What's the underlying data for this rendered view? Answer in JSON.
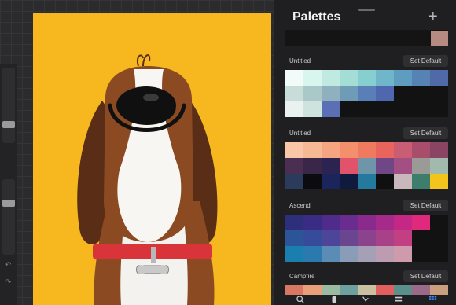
{
  "panel": {
    "title": "Palettes",
    "add_label": "+"
  },
  "palettes": [
    {
      "name": "Untitled",
      "button": "Set Default",
      "rows": [
        [
          "#f2fbf7",
          "#d8f5ee",
          "#bfe9e1",
          "#a3ddd6",
          "#86ced0",
          "#6fb7c8",
          "#5e9dbf",
          "#5783b4",
          "#4f6aa6"
        ],
        [
          "#c8ddd7",
          "#abc8c8",
          "#8fb1bf",
          "#6f9bb7",
          "#5a7fb8",
          "#4f67ae",
          "#121212",
          "#121212",
          "#121212"
        ],
        [
          "#e9f2ee",
          "#cfe3de",
          "#5b6fb4",
          "#121212",
          "#121212",
          "#121212",
          "#121212",
          "#121212",
          "#121212"
        ]
      ]
    },
    {
      "name": "Untitled",
      "button": "Set Default",
      "rows": [
        [
          "#f9c7a7",
          "#f6b996",
          "#f5a57f",
          "#f38f6c",
          "#ef7a60",
          "#e8645c",
          "#c85d74",
          "#a84d6c",
          "#8a4464"
        ],
        [
          "#4a2f52",
          "#3a2748",
          "#2b2450",
          "#e0536a",
          "#6f95a8",
          "#6f4686",
          "#a34f84",
          "#9a9a96",
          "#a2b9ad"
        ],
        [
          "#2a3b5c",
          "#0c0c10",
          "#1c245c",
          "#0f1a3c",
          "#247a9c",
          "#101010",
          "#c8b8bc",
          "#3d7d6c",
          "#f2c41c"
        ]
      ]
    },
    {
      "name": "Ascend",
      "button": "Set Default",
      "rows": [
        [
          "#2e2f7a",
          "#3a2c84",
          "#4f2c8c",
          "#6a2c8e",
          "#892a8c",
          "#a62a8a",
          "#c52884",
          "#e0287c",
          "#121212"
        ],
        [
          "#2b5596",
          "#364c9a",
          "#4d4698",
          "#6a4590",
          "#8a438c",
          "#a84188",
          "#c23f84",
          "#121212",
          "#121212"
        ],
        [
          "#1a7eae",
          "#2a7ab0",
          "#5b8cb6",
          "#8b9cb8",
          "#a6a0b6",
          "#bd9cb2",
          "#cf9aac",
          "#121212",
          "#121212"
        ]
      ]
    },
    {
      "name": "Campfire",
      "button": "Set Default",
      "rows": []
    }
  ],
  "top_partial_color": "#b58a80",
  "tabs": [
    "search-icon",
    "brush-icon",
    "smudge-icon",
    "layers-icon",
    "palettes-icon"
  ]
}
